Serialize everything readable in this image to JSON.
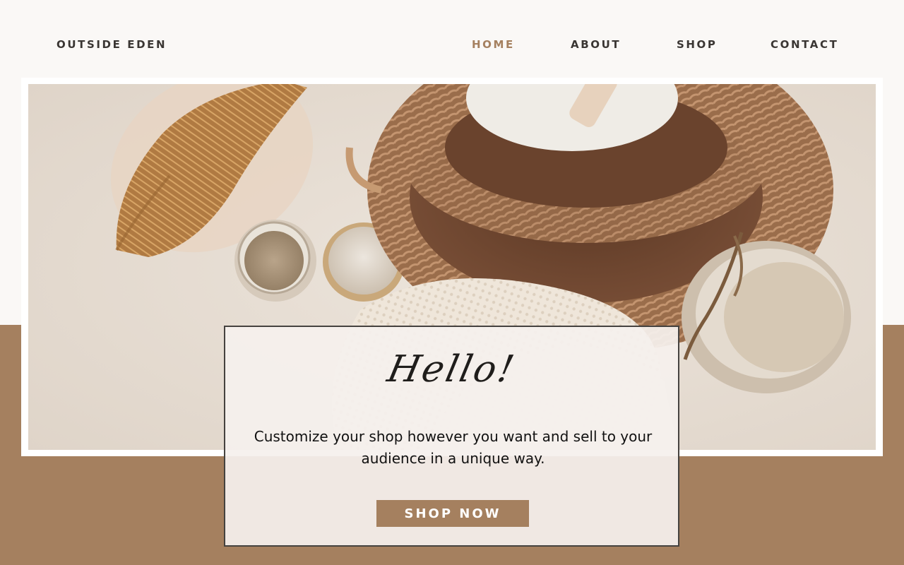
{
  "header": {
    "brand": "OUTSIDE EDEN",
    "nav": [
      {
        "label": "HOME",
        "active": true
      },
      {
        "label": "ABOUT",
        "active": false
      },
      {
        "label": "SHOP",
        "active": false
      },
      {
        "label": "CONTACT",
        "active": false
      }
    ]
  },
  "hero": {
    "image_alt": "Natural body care products: bristle brush, jars, woven basket, loofah"
  },
  "card": {
    "greeting": "Hello!",
    "tagline": "Customize your shop however you want and sell to your audience in a unique way.",
    "cta": "SHOP NOW"
  },
  "colors": {
    "accent": "#a5805f",
    "text": "#3a3633",
    "background": "#faf8f6"
  }
}
